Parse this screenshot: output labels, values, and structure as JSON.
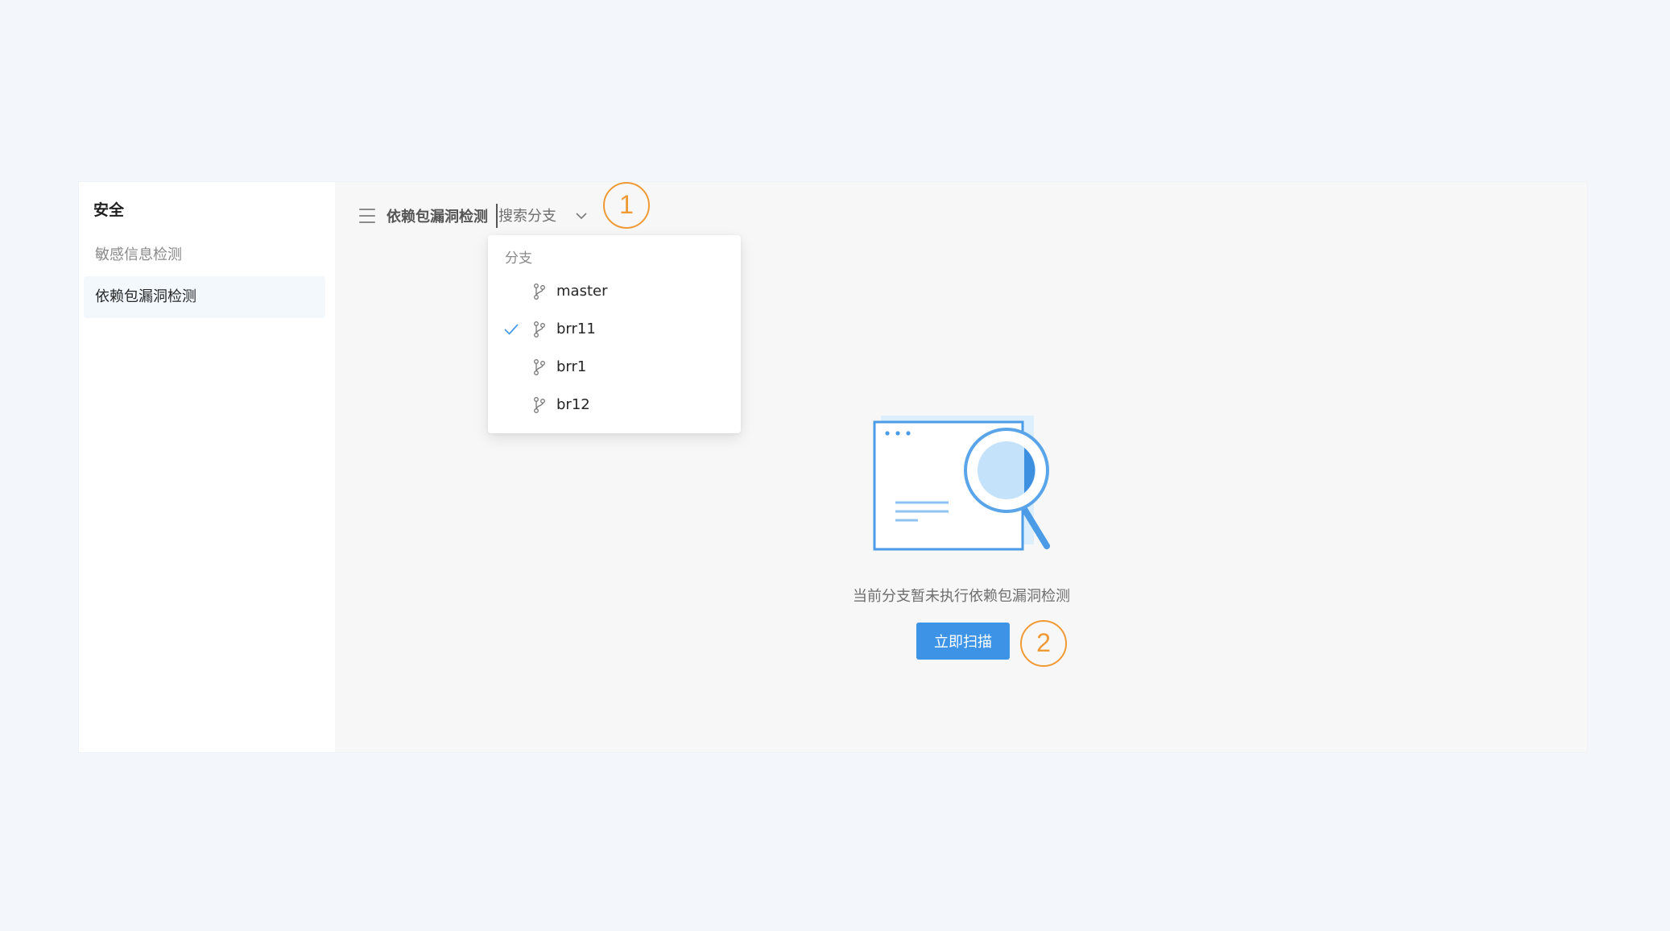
{
  "sidebar": {
    "title": "安全",
    "items": [
      {
        "label": "敏感信息检测",
        "active": false
      },
      {
        "label": "依赖包漏洞检测",
        "active": true
      }
    ]
  },
  "toolbar": {
    "menu_icon": "menu-icon",
    "title": "依赖包漏洞检测",
    "branch_search": {
      "value": "",
      "placeholder": "搜索分支"
    },
    "chevron_icon": "chevron-down-icon"
  },
  "dropdown": {
    "group_label": "分支",
    "options": [
      {
        "label": "master",
        "selected": false,
        "icon": "branch-icon"
      },
      {
        "label": "brr11",
        "selected": true,
        "icon": "branch-icon"
      },
      {
        "label": "brr1",
        "selected": false,
        "icon": "branch-icon"
      },
      {
        "label": "br12",
        "selected": false,
        "icon": "branch-icon"
      }
    ]
  },
  "empty_state": {
    "illustration_icon": "search-document-illustration",
    "message": "当前分支暂未执行依赖包漏洞检测",
    "scan_button_label": "立即扫描"
  },
  "annotations": {
    "marker_1": "1",
    "marker_2": "2"
  },
  "colors": {
    "accent": "#3d94e6",
    "marker": "#ef9a35",
    "check": "#4a9be8"
  }
}
